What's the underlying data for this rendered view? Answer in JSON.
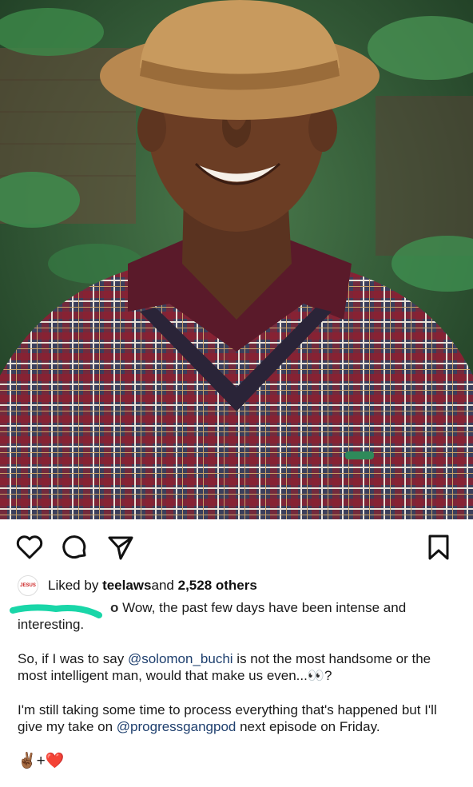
{
  "post": {
    "liked_by_prefix": "Liked by ",
    "liked_by_user": "teelaws",
    "liked_by_mid": " and ",
    "liked_by_count": "2,528 others",
    "avatar_text": "JESUS"
  },
  "caption": {
    "username_visible": "o",
    "line1_text": " Wow, the past few days have been intense and interesting.",
    "p2_a": "So, if I was to say ",
    "p2_mention": "@solomon_buchi",
    "p2_b": " is not the most handsome or the most intelligent man, would that make us even...👀?",
    "p3_a": "I'm still taking some time to process everything that's happened but I'll give my take on ",
    "p3_mention": "@progressgangpod",
    "p3_b": " next episode on Friday.",
    "emoji": "✌🏾+❤️"
  },
  "colors": {
    "mention": "#1e3f6e",
    "scribble": "#19d6a8"
  },
  "icons": [
    "heart-icon",
    "comment-icon",
    "share-icon",
    "bookmark-icon"
  ]
}
